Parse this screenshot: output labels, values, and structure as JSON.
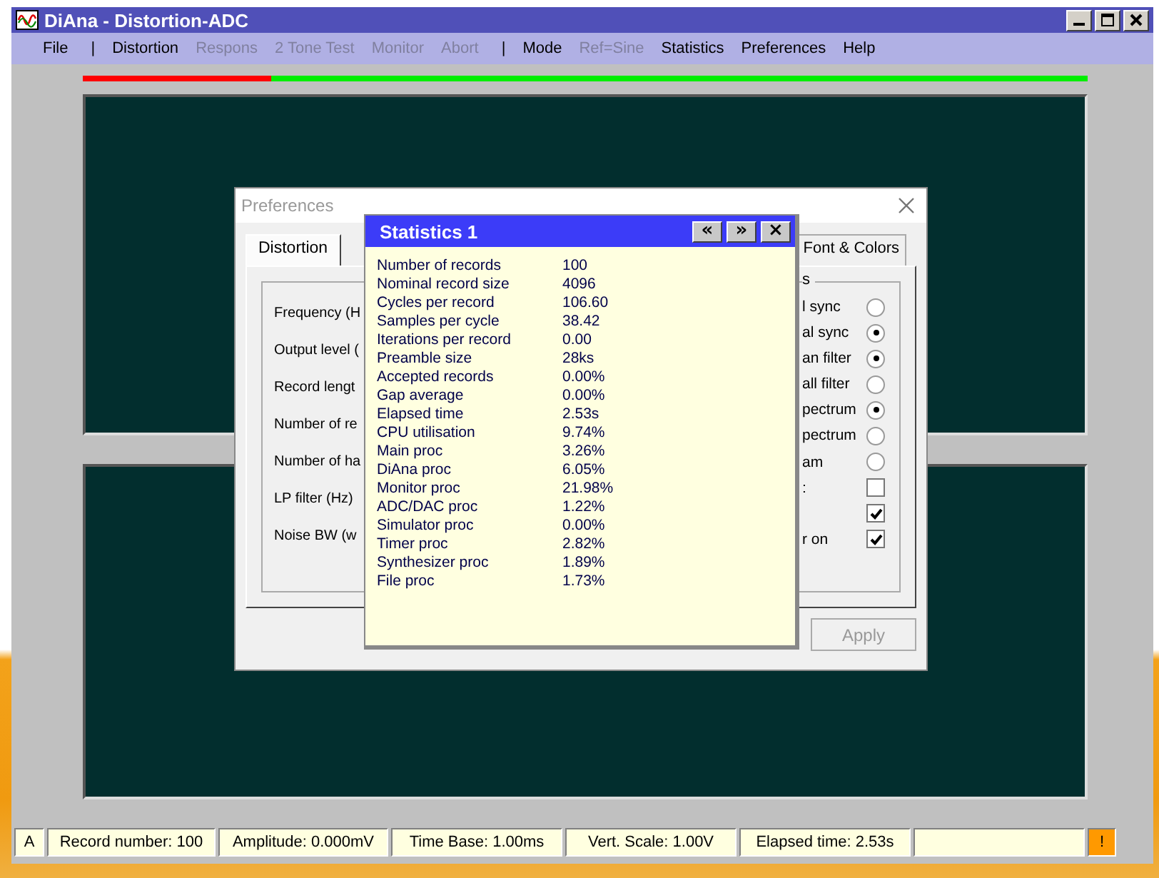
{
  "window": {
    "title": "DiAna - Distortion-ADC"
  },
  "menu": [
    {
      "kind": "item",
      "label": "File",
      "disabled": false
    },
    {
      "kind": "separator",
      "label": "|"
    },
    {
      "kind": "item",
      "label": "Distortion",
      "disabled": false
    },
    {
      "kind": "item",
      "label": "Respons",
      "disabled": true
    },
    {
      "kind": "item",
      "label": "2 Tone Test",
      "disabled": true
    },
    {
      "kind": "item",
      "label": "Monitor",
      "disabled": true
    },
    {
      "kind": "item",
      "label": "Abort",
      "disabled": true
    },
    {
      "kind": "separator",
      "label": "|"
    },
    {
      "kind": "item",
      "label": "Mode",
      "disabled": false
    },
    {
      "kind": "item",
      "label": "Ref=Sine",
      "disabled": true
    },
    {
      "kind": "item",
      "label": "Statistics",
      "disabled": false
    },
    {
      "kind": "item",
      "label": "Preferences",
      "disabled": false
    },
    {
      "kind": "item",
      "label": "Help",
      "disabled": false
    }
  ],
  "progress": {
    "level": 0.187
  },
  "preferences": {
    "title": "Preferences",
    "tabs": [
      {
        "label": "Distortion",
        "selected": true
      },
      {
        "label": "Font & Colors",
        "selected": false
      }
    ],
    "fields": [
      "Frequency (H",
      "Output level (",
      "Record lengt",
      "Number of re",
      "Number of ha",
      "LP filter (Hz)",
      "Noise BW (w"
    ],
    "group_title": "s",
    "options": [
      {
        "kind": "radio",
        "label": "l sync",
        "checked": false
      },
      {
        "kind": "radio",
        "label": "al sync",
        "checked": true
      },
      {
        "kind": "radio",
        "label": "an filter",
        "checked": true
      },
      {
        "kind": "radio",
        "label": "all filter",
        "checked": false
      },
      {
        "kind": "radio",
        "label": "pectrum",
        "checked": true
      },
      {
        "kind": "radio",
        "label": "pectrum",
        "checked": false
      },
      {
        "kind": "radio",
        "label": "am",
        "checked": false
      },
      {
        "kind": "checkbox",
        "label": ":",
        "checked": false
      },
      {
        "kind": "checkbox",
        "checked": true
      },
      {
        "kind": "checkbox",
        "label": "r on",
        "checked": true
      }
    ],
    "apply": {
      "label": "Apply",
      "disabled": true
    }
  },
  "statistics": {
    "title": "Statistics 1",
    "buttons": [
      "«",
      "»",
      "×"
    ],
    "rows": [
      {
        "label": "Number of records",
        "value": "100"
      },
      {
        "label": "Nominal record size",
        "value": "4096"
      },
      {
        "label": "Cycles per record",
        "value": "106.60"
      },
      {
        "label": "Samples per cycle",
        "value": "38.42"
      },
      {
        "label": "Iterations per record",
        "value": "0.00"
      },
      {
        "label": "Preamble size",
        "value": "28ks"
      },
      {
        "label": "Accepted records",
        "value": "0.00%"
      },
      {
        "label": "Gap average",
        "value": "0.00%"
      },
      {
        "label": "Elapsed time",
        "value": "2.53s"
      },
      {
        "label": "CPU utilisation",
        "value": "9.74%"
      },
      {
        "label": "Main proc",
        "value": "3.26%"
      },
      {
        "label": "DiAna proc",
        "value": "6.05%"
      },
      {
        "label": "Monitor proc",
        "value": "21.98%"
      },
      {
        "label": "ADC/DAC proc",
        "value": "1.22%"
      },
      {
        "label": "Simulator proc",
        "value": "0.00%"
      },
      {
        "label": "Timer proc",
        "value": "2.82%"
      },
      {
        "label": "Synthesizer proc",
        "value": "1.89%"
      },
      {
        "label": "File proc",
        "value": "1.73%"
      }
    ]
  },
  "status_bar": [
    "A",
    "Record number: 100",
    "Amplitude: 0.000mV",
    "Time Base: 1.00ms",
    "Vert. Scale: 1.00V",
    "Elapsed time: 2.53s"
  ],
  "status_warning": "!"
}
